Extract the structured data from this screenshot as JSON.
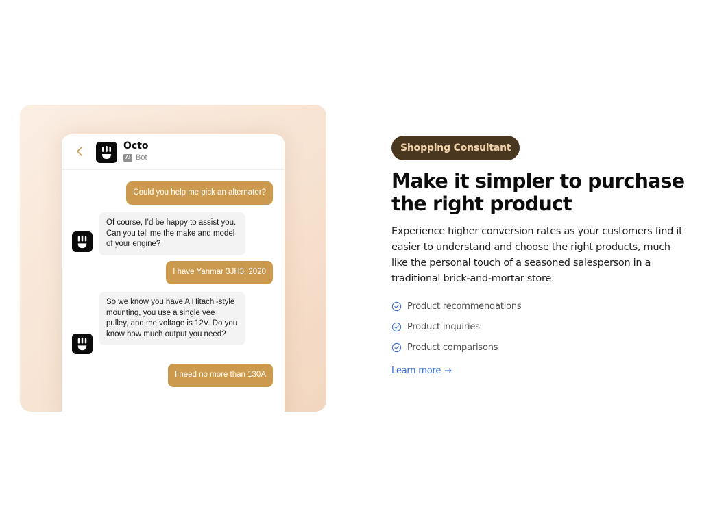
{
  "chat_preview": {
    "bot_name": "Octo",
    "bot_badge": "AI",
    "bot_label": "Bot",
    "messages": [
      {
        "role": "user",
        "text": "Could you help me pick an alternator?"
      },
      {
        "role": "bot",
        "text": "Of course, I’d be happy to assist you. Can you tell me the make and model of your engine?"
      },
      {
        "role": "user",
        "text": "I have Yanmar 3JH3, 2020"
      },
      {
        "role": "bot",
        "text": "So we know you have A Hitachi-style mounting, you use a single vee pulley, and the voltage is 12V. Do you know how much output you need?"
      },
      {
        "role": "user",
        "text": "I need no more than 130A"
      }
    ]
  },
  "content": {
    "tag": "Shopping Consultant",
    "headline": "Make it simpler to purchase the right product",
    "description": "Experience higher conversion rates as your customers find it easier to understand and choose the right products, much like the personal touch of a seasoned salesperson in a traditional brick-and-mortar store.",
    "features": [
      "Product recommendations",
      "Product inquiries",
      "Product comparisons"
    ],
    "learn_more": "Learn more",
    "learn_more_arrow": "→"
  },
  "colors": {
    "user_bubble": "#cc9a4e",
    "bot_bubble": "#f3f3f3",
    "tag_bg": "#4a3720",
    "tag_text": "#f1d2a9",
    "link": "#3b6fd6",
    "check": "#3b6fd6"
  }
}
